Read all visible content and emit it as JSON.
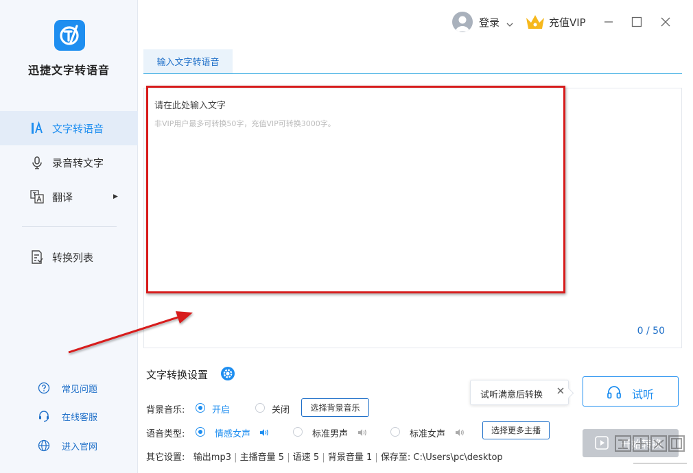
{
  "app": {
    "name": "迅捷文字转语音"
  },
  "sidebar": {
    "items": [
      {
        "label": "文字转语音"
      },
      {
        "label": "录音转文字"
      },
      {
        "label": "翻译"
      },
      {
        "label": "转换列表"
      }
    ],
    "footer": [
      {
        "label": "常见问题"
      },
      {
        "label": "在线客服"
      },
      {
        "label": "进入官网"
      }
    ]
  },
  "header": {
    "login_label": "登录",
    "vip_label": "充值VIP"
  },
  "tabs": [
    {
      "label": "输入文字转语音"
    }
  ],
  "editor": {
    "placeholder": "请在此处输入文字",
    "hint": "非VIP用户最多可转换50字，充值VIP可转换3000字。",
    "counter": "0 / 50"
  },
  "settings": {
    "title": "文字转换设置",
    "bg_music": {
      "label": "背景音乐:",
      "options": [
        {
          "label": "开启",
          "selected": true
        },
        {
          "label": "关闭",
          "selected": false
        }
      ],
      "button": "选择背景音乐"
    },
    "voice": {
      "label": "语音类型:",
      "options": [
        {
          "label": "情感女声",
          "selected": true
        },
        {
          "label": "标准男声",
          "selected": false
        },
        {
          "label": "标准女声",
          "selected": false
        }
      ],
      "button": "选择更多主播"
    },
    "other": {
      "label": "其它设置:",
      "format": "输出mp3",
      "host_volume": "主播音量 5",
      "speed": "语速 5",
      "bg_volume": "背景音量 1",
      "save_path": "保存至: C:\\Users\\pc\\desktop"
    }
  },
  "tooltip": {
    "text": "试听满意后转换"
  },
  "actions": {
    "listen_label": "试听",
    "start_label": "开始转换"
  },
  "colors": {
    "accent": "#1e8ef0",
    "annotation": "#d71b1b",
    "disabled": "#c4c8ce"
  }
}
